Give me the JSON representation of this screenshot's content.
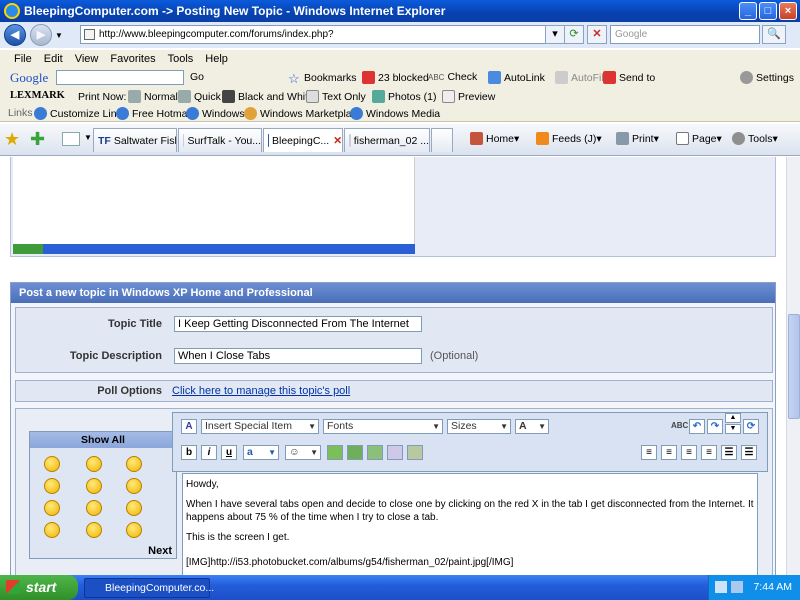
{
  "window": {
    "title": "BleepingComputer.com -> Posting New Topic - Windows Internet Explorer"
  },
  "address": {
    "url": "http://www.bleepingcomputer.com/forums/index.php?",
    "search_placeholder": "Google"
  },
  "menu": [
    "File",
    "Edit",
    "View",
    "Favorites",
    "Tools",
    "Help"
  ],
  "google_bar": {
    "logo": "Google",
    "go": "Go",
    "bookmarks": "Bookmarks",
    "blocked": "23 blocked",
    "check": "Check",
    "autolink": "AutoLink",
    "autofill": "AutoFill",
    "sendto": "Send to",
    "settings": "Settings"
  },
  "lexmark_bar": {
    "logo": "LEXMARK",
    "print_now": "Print Now:",
    "normal": "Normal",
    "quick": "Quick",
    "bw": "Black and White",
    "text_only": "Text Only",
    "photos": "Photos (1)",
    "preview": "Preview"
  },
  "links_bar": {
    "label": "Links",
    "items": [
      "Customize Links",
      "Free Hotmail",
      "Windows",
      "Windows Marketplace",
      "Windows Media"
    ]
  },
  "tabs": [
    "Saltwater Fish...",
    "SurfTalk - You...",
    "BleepingC...",
    "fisherman_02 ..."
  ],
  "tab_tf_badge": "TF",
  "commandbar": {
    "home": "Home",
    "feeds": "Feeds (J)",
    "print": "Print",
    "page": "Page",
    "tools": "Tools"
  },
  "form": {
    "header": "Post a new topic in Windows XP Home and Professional",
    "topic_title_label": "Topic Title",
    "topic_title_value": "I Keep Getting Disconnected From The Internet",
    "topic_desc_label": "Topic Description",
    "topic_desc_value": "When I Close Tabs",
    "optional": "(Optional)",
    "poll_label": "Poll Options",
    "poll_link": "Click here to manage this topic's poll"
  },
  "smilies": {
    "show_all": "Show All",
    "next": "Next"
  },
  "editor": {
    "special_item": "Insert Special Item",
    "fonts": "Fonts",
    "sizes": "Sizes",
    "bold": "b",
    "italic": "i",
    "underline": "u",
    "body": [
      "Howdy,",
      "When I have several tabs open and decide to close one by clicking on the red X in the tab I get disconnected from the Internet. It happens about 75 % of the time when I try to close a tab.",
      "This is the screen I get.",
      "[IMG]http://i53.photobucket.com/albums/g54/fisherman_02/paint.jpg[/IMG]"
    ]
  },
  "taskbar": {
    "start": "start",
    "item": "BleepingComputer.co...",
    "clock": "7:44 AM"
  },
  "colors": {
    "titlebar": "#0842b0",
    "form_header": "#4a6fb9",
    "link": "#0033aa"
  }
}
